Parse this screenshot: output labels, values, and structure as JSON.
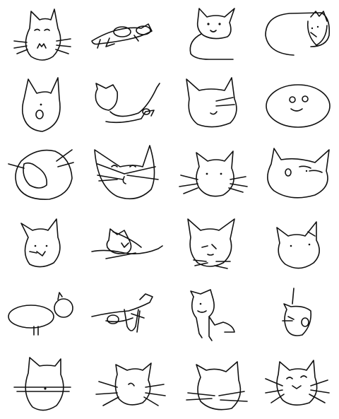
{
  "sheet": {
    "background": "#ffffff",
    "ink": "#111111",
    "grid": {
      "rows": 6,
      "columns": 4
    },
    "drawings": [
      {
        "subject": "cat",
        "style": "face-front"
      },
      {
        "subject": "cat",
        "style": "scribble-lying"
      },
      {
        "subject": "cat",
        "style": "face-with-body"
      },
      {
        "subject": "cat",
        "style": "round-blob"
      },
      {
        "subject": "cat",
        "style": "face-front"
      },
      {
        "subject": "cat",
        "style": "lying-profile"
      },
      {
        "subject": "cat",
        "style": "face-front"
      },
      {
        "subject": "cat",
        "style": "round-blob"
      },
      {
        "subject": "cat",
        "style": "scribble-circle"
      },
      {
        "subject": "cat",
        "style": "face-front"
      },
      {
        "subject": "cat",
        "style": "face-front"
      },
      {
        "subject": "cat",
        "style": "face-front"
      },
      {
        "subject": "cat",
        "style": "face-front"
      },
      {
        "subject": "cat",
        "style": "scribble-lying"
      },
      {
        "subject": "cat",
        "style": "face-front"
      },
      {
        "subject": "cat",
        "style": "face-front"
      },
      {
        "subject": "cat",
        "style": "body-and-head"
      },
      {
        "subject": "cat",
        "style": "scribble-body"
      },
      {
        "subject": "cat",
        "style": "sitting"
      },
      {
        "subject": "cat",
        "style": "face-side"
      },
      {
        "subject": "cat",
        "style": "face-front"
      },
      {
        "subject": "cat",
        "style": "face-front"
      },
      {
        "subject": "cat",
        "style": "face-front"
      },
      {
        "subject": "cat",
        "style": "face-front"
      }
    ]
  }
}
